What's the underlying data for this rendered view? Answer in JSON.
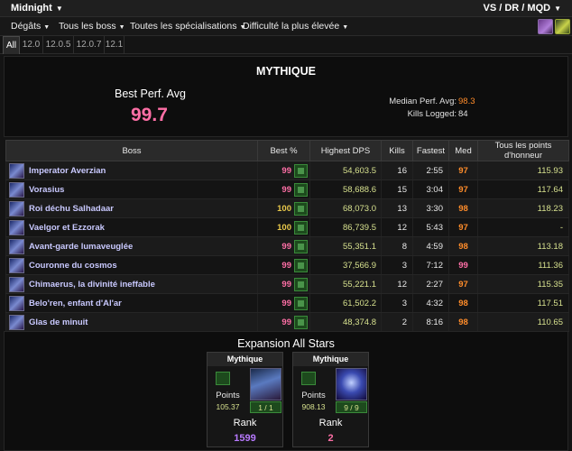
{
  "topbar": {
    "zone": "Midnight",
    "right": "VS / DR / MQD"
  },
  "menu": [
    {
      "label": "Dégâts"
    },
    {
      "label": "Tous les boss"
    },
    {
      "label": "Toutes les spécialisations"
    },
    {
      "label": "Difficulté la plus élevée"
    }
  ],
  "tabs": [
    "All",
    "12.0",
    "12.0.5",
    "12.0.7",
    "12.1"
  ],
  "summary": {
    "mode": "MYTHIQUE",
    "best_label": "Best Perf. Avg",
    "best_value": "99.7",
    "median_label": "Median Perf. Avg:",
    "median_value": "98.3",
    "kills_label": "Kills Logged:",
    "kills_value": "84"
  },
  "table": {
    "headers": [
      "Boss",
      "Best %",
      "Highest DPS",
      "Kills",
      "Fastest",
      "Med",
      "Tous les points d'honneur"
    ],
    "rows": [
      {
        "boss": "Imperator Averzian",
        "best": "99",
        "dps": "54,603.5",
        "kills": "16",
        "fastest": "2:55",
        "med": "97",
        "allstars": "115.93"
      },
      {
        "boss": "Vorasius",
        "best": "99",
        "dps": "58,688.6",
        "kills": "15",
        "fastest": "3:04",
        "med": "97",
        "allstars": "117.64"
      },
      {
        "boss": "Roi déchu Salhadaar",
        "best": "100",
        "dps": "68,073.0",
        "kills": "13",
        "fastest": "3:30",
        "med": "98",
        "allstars": "118.23"
      },
      {
        "boss": "Vaelgor et Ezzorak",
        "best": "100",
        "dps": "86,739.5",
        "kills": "12",
        "fastest": "5:43",
        "med": "97",
        "allstars": "-"
      },
      {
        "boss": "Avant-garde lumaveuglée",
        "best": "99",
        "dps": "55,351.1",
        "kills": "8",
        "fastest": "4:59",
        "med": "98",
        "allstars": "113.18"
      },
      {
        "boss": "Couronne du cosmos",
        "best": "99",
        "dps": "37,566.9",
        "kills": "3",
        "fastest": "7:12",
        "med": "99",
        "allstars": "111.36"
      },
      {
        "boss": "Chimaerus, la divinité ineffable",
        "best": "99",
        "dps": "55,221.1",
        "kills": "12",
        "fastest": "2:27",
        "med": "97",
        "allstars": "115.35"
      },
      {
        "boss": "Belo'ren, enfant d'Al'ar",
        "best": "99",
        "dps": "61,502.2",
        "kills": "3",
        "fastest": "4:32",
        "med": "98",
        "allstars": "117.51"
      },
      {
        "boss": "Glas de minuit",
        "best": "99",
        "dps": "48,374.8",
        "kills": "2",
        "fastest": "8:16",
        "med": "98",
        "allstars": "110.65"
      }
    ]
  },
  "allstars": {
    "title": "Expansion All Stars",
    "cards": [
      {
        "head": "Mythique",
        "points_label": "Points",
        "points": "105.37",
        "fraction": "1 / 1",
        "rank_label": "Rank",
        "rank": "1599"
      },
      {
        "head": "Mythique",
        "points_label": "Points",
        "points": "908.13",
        "fraction": "9 / 9",
        "rank_label": "Rank",
        "rank": "2"
      }
    ]
  },
  "colors": {
    "pink": "#ff6fa6",
    "gold": "#e8c84a",
    "orange": "#ff8c2a",
    "dps": "#d6e08e",
    "boss": "#c9c9ff",
    "purple": "#b87aff"
  }
}
